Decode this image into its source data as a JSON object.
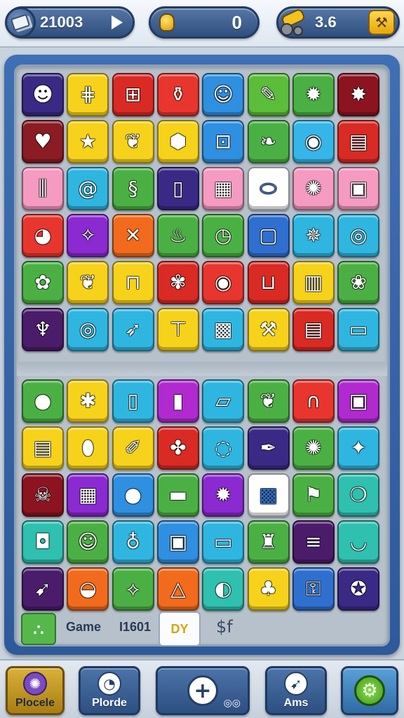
{
  "top_bar": {
    "coins": "21003",
    "pot": "0",
    "boost": "3.6"
  },
  "board": {
    "upper_grid": [
      [
        {
          "color": "#3a2a86",
          "icon": "chef"
        },
        {
          "color": "#f6d21b",
          "icon": "ladder"
        },
        {
          "color": "#d92a24",
          "icon": "gift"
        },
        {
          "color": "#e8362e",
          "icon": "jar"
        },
        {
          "color": "#2f8fe0",
          "icon": "worker"
        },
        {
          "color": "#5bbd3a",
          "icon": "pencil"
        },
        {
          "color": "#4bb043",
          "icon": "gear"
        },
        {
          "color": "#8b1420",
          "icon": "splash"
        }
      ],
      [
        {
          "color": "#8b1c24",
          "icon": "heart"
        },
        {
          "color": "#f6d21b",
          "icon": "star"
        },
        {
          "color": "#f6d21b",
          "icon": "leaf"
        },
        {
          "color": "#f6d21b",
          "icon": "cube"
        },
        {
          "color": "#2f8fe0",
          "icon": "bag"
        },
        {
          "color": "#4bb043",
          "icon": "bird"
        },
        {
          "color": "#36b6e8",
          "icon": "globe"
        },
        {
          "color": "#d92a24",
          "icon": "screen"
        }
      ],
      [
        {
          "color": "#f59ac0",
          "icon": "bottles"
        },
        {
          "color": "#2fb6e0",
          "icon": "spiral"
        },
        {
          "color": "#4bb043",
          "icon": "snake"
        },
        {
          "color": "#3a2a86",
          "icon": "phone"
        },
        {
          "color": "#f59ac0",
          "icon": "calendar"
        },
        {
          "color": "#ffffff",
          "icon": "football"
        },
        {
          "color": "#f59ac0",
          "icon": "cog"
        },
        {
          "color": "#f59ac0",
          "icon": "case"
        }
      ],
      [
        {
          "color": "#e8362e",
          "icon": "pizza"
        },
        {
          "color": "#8a2ad0",
          "icon": "compass"
        },
        {
          "color": "#f26b1d",
          "icon": "cross"
        },
        {
          "color": "#4bb043",
          "icon": "teapot"
        },
        {
          "color": "#4bb043",
          "icon": "clock"
        },
        {
          "color": "#2f6fd0",
          "icon": "jar2"
        },
        {
          "color": "#2fb6e0",
          "icon": "crab"
        },
        {
          "color": "#2fb6e0",
          "icon": "target"
        }
      ],
      [
        {
          "color": "#4bb043",
          "icon": "flower"
        },
        {
          "color": "#f6d21b",
          "icon": "leaf2"
        },
        {
          "color": "#f6d21b",
          "icon": "lock"
        },
        {
          "color": "#d92a24",
          "icon": "donut"
        },
        {
          "color": "#e8362e",
          "icon": "bullseye"
        },
        {
          "color": "#d92a24",
          "icon": "basket"
        },
        {
          "color": "#f6d21b",
          "icon": "chart"
        },
        {
          "color": "#4bb043",
          "icon": "rose"
        }
      ],
      [
        {
          "color": "#4a1c6a",
          "icon": "torch"
        },
        {
          "color": "#2fb6e0",
          "icon": "ring"
        },
        {
          "color": "#2fb6e0",
          "icon": "arrow"
        },
        {
          "color": "#f6d21b",
          "icon": "stool"
        },
        {
          "color": "#2fb6e0",
          "icon": "box"
        },
        {
          "color": "#f6d21b",
          "icon": "tools"
        },
        {
          "color": "#d92a24",
          "icon": "news"
        },
        {
          "color": "#2fb6e0",
          "icon": "monitor"
        }
      ]
    ],
    "lower_grid": [
      [
        {
          "color": "#4bb043",
          "icon": "avocado"
        },
        {
          "color": "#f6d21b",
          "icon": "bug"
        },
        {
          "color": "#2fb6e0",
          "icon": "tablet"
        },
        {
          "color": "#b02ad0",
          "icon": "battery"
        },
        {
          "color": "#2fb6e0",
          "icon": "ticket"
        },
        {
          "color": "#4bb043",
          "icon": "seed"
        },
        {
          "color": "#e8362e",
          "icon": "magnet"
        },
        {
          "color": "#b02ad0",
          "icon": "pot"
        }
      ],
      [
        {
          "color": "#f6d21b",
          "icon": "tablet2"
        },
        {
          "color": "#f6d21b",
          "icon": "whistle"
        },
        {
          "color": "#f6d21b",
          "icon": "brush"
        },
        {
          "color": "#d92a24",
          "icon": "cactus"
        },
        {
          "color": "#2fb6e0",
          "icon": "lens"
        },
        {
          "color": "#3a2a86",
          "icon": "pen"
        },
        {
          "color": "#4bb043",
          "icon": "sun"
        },
        {
          "color": "#2fb6e0",
          "icon": "kite"
        }
      ],
      [
        {
          "color": "#8b1420",
          "icon": "skull"
        },
        {
          "color": "#8a2ad0",
          "icon": "crate"
        },
        {
          "color": "#2f8fe0",
          "icon": "berry"
        },
        {
          "color": "#4bb043",
          "icon": "card"
        },
        {
          "color": "#8a2ad0",
          "icon": "virus"
        },
        {
          "color": "#ffffff",
          "icon": "purse"
        },
        {
          "color": "#4bb043",
          "icon": "flag"
        },
        {
          "color": "#2fc0b0",
          "icon": "squash"
        }
      ],
      [
        {
          "color": "#2fc0b0",
          "icon": "cam"
        },
        {
          "color": "#4bb043",
          "icon": "panda"
        },
        {
          "color": "#2fb6e0",
          "icon": "bulb"
        },
        {
          "color": "#2f8fe0",
          "icon": "frame"
        },
        {
          "color": "#2fb6e0",
          "icon": "roll"
        },
        {
          "color": "#4bb043",
          "icon": "bottle"
        },
        {
          "color": "#4a1c6a",
          "icon": "cannon"
        },
        {
          "color": "#2fc0b0",
          "icon": "bowl"
        }
      ],
      [
        {
          "color": "#4a1c6a",
          "icon": "rocket"
        },
        {
          "color": "#f26b1d",
          "icon": "shell"
        },
        {
          "color": "#4bb043",
          "icon": "fish"
        },
        {
          "color": "#f26b1d",
          "icon": "cone"
        },
        {
          "color": "#2fc0b0",
          "icon": "ball"
        },
        {
          "color": "#f6d21b",
          "icon": "plant"
        },
        {
          "color": "#2f6fd0",
          "icon": "keys"
        },
        {
          "color": "#3a2a86",
          "icon": "bird2"
        }
      ]
    ]
  },
  "strip": {
    "label_game": "Game",
    "label_code": "I1601",
    "card_text": "DY",
    "symbol": "$f"
  },
  "nav": [
    {
      "label": "Plocele",
      "icon": "blob-icon"
    },
    {
      "label": "Plorde",
      "icon": "timer-icon"
    },
    {
      "label": "",
      "icon": "plus-icon"
    },
    {
      "label": "Ams",
      "icon": "compass-icon"
    },
    {
      "label": "",
      "icon": "settings-icon"
    }
  ]
}
